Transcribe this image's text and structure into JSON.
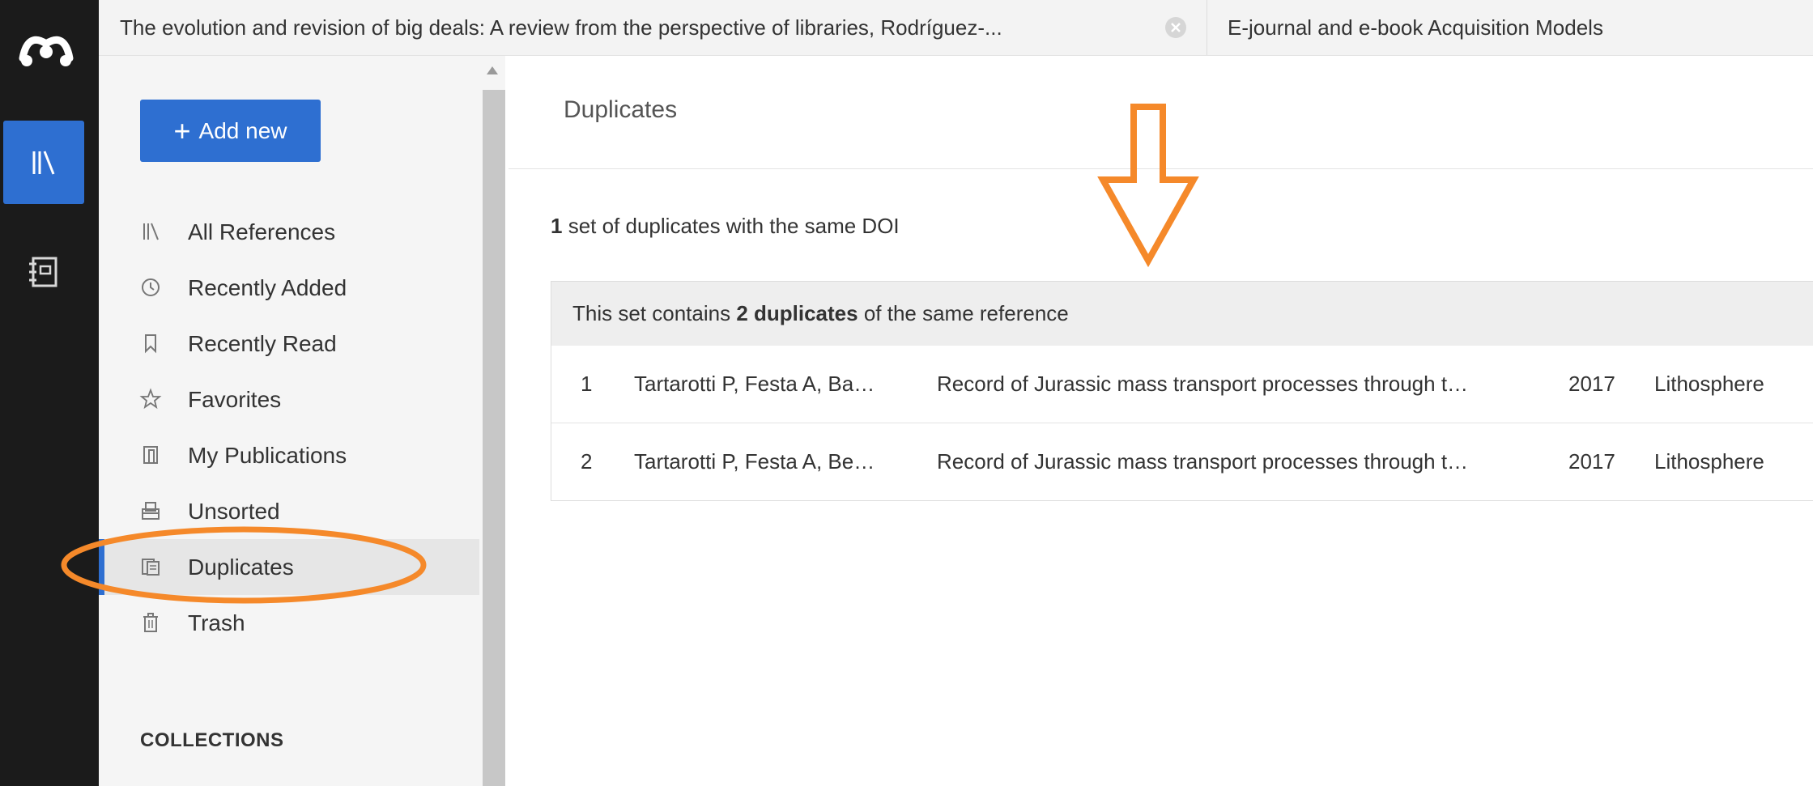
{
  "tabs": [
    {
      "title": "The evolution and revision of big deals: A review from the perspective of libraries, Rodríguez-..."
    },
    {
      "title": "E-journal and e-book Acquisition Models"
    }
  ],
  "rail": {
    "items": [
      {
        "icon": "mendeley-logo-icon"
      },
      {
        "icon": "library-icon",
        "active": true
      },
      {
        "icon": "notebook-icon"
      }
    ]
  },
  "sidebar": {
    "add_button": "Add new",
    "items": [
      {
        "label": "All References",
        "icon": "library-icon"
      },
      {
        "label": "Recently Added",
        "icon": "clock-icon"
      },
      {
        "label": "Recently Read",
        "icon": "bookmark-icon"
      },
      {
        "label": "Favorites",
        "icon": "star-icon"
      },
      {
        "label": "My Publications",
        "icon": "publications-icon"
      },
      {
        "label": "Unsorted",
        "icon": "inbox-icon"
      },
      {
        "label": "Duplicates",
        "icon": "duplicates-icon",
        "active": true
      },
      {
        "label": "Trash",
        "icon": "trash-icon"
      }
    ],
    "collections_heading": "COLLECTIONS"
  },
  "main": {
    "title": "Duplicates",
    "summary_count": "1",
    "summary_text": " set of duplicates with the same DOI",
    "set_header_prefix": "This set contains ",
    "set_header_bold": "2 duplicates",
    "set_header_suffix": " of the same reference",
    "rows": [
      {
        "num": "1",
        "authors": "Tartarotti P, Festa A, Ba…",
        "title": "Record of Jurassic mass transport processes through t…",
        "year": "2017",
        "source": "Lithosphere"
      },
      {
        "num": "2",
        "authors": "Tartarotti P, Festa A, Be…",
        "title": "Record of Jurassic mass transport processes through t…",
        "year": "2017",
        "source": "Lithosphere"
      }
    ]
  },
  "colors": {
    "accent": "#2e6fd1",
    "annotation": "#f5892a",
    "rail_background": "#1b1b1b",
    "sidebar_background": "#f5f5f5"
  }
}
